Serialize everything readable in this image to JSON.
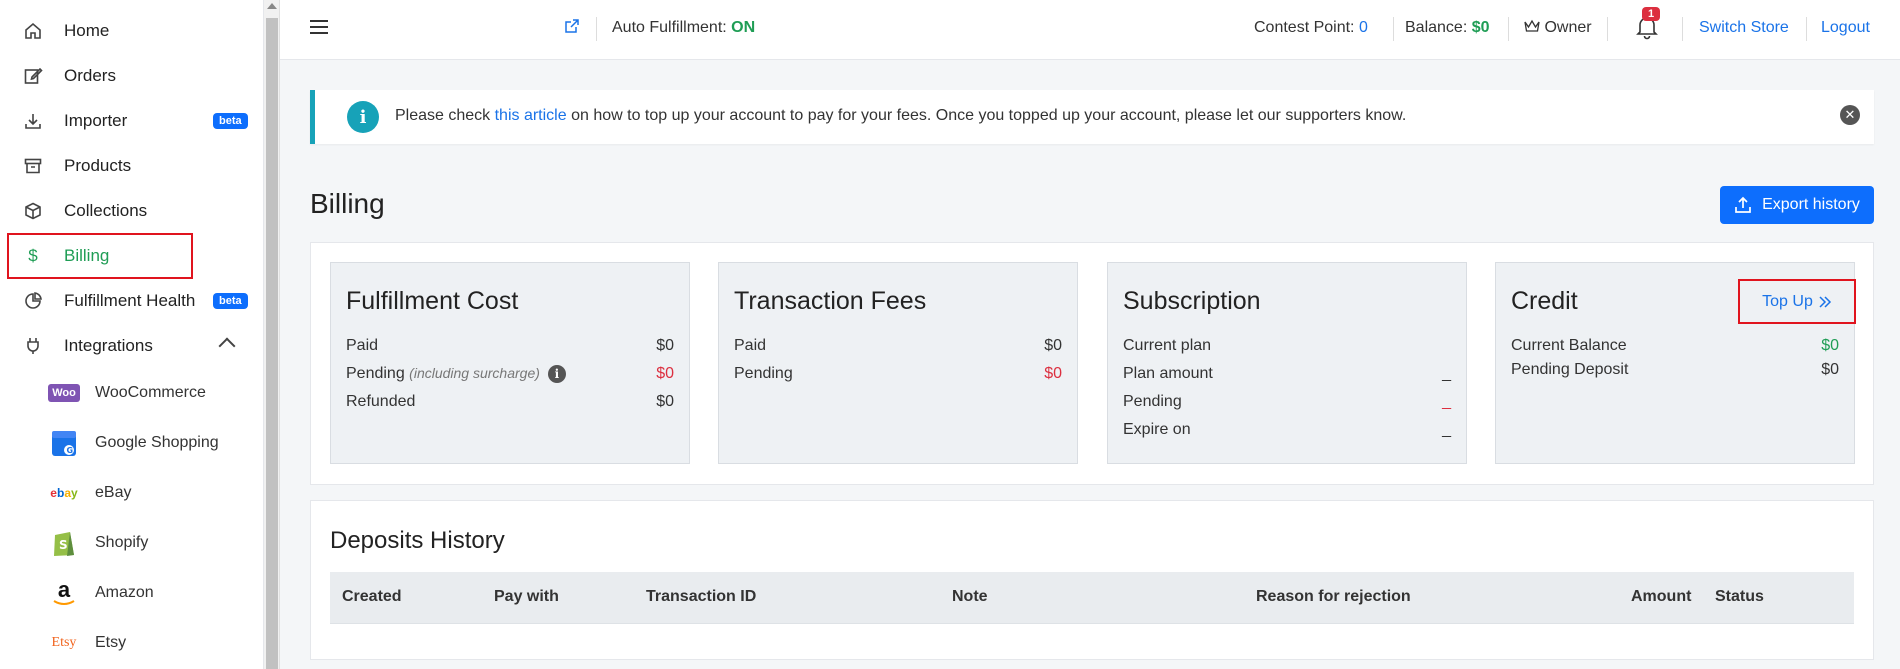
{
  "sidebar": {
    "items": [
      {
        "label": "Home"
      },
      {
        "label": "Orders"
      },
      {
        "label": "Importer",
        "badge": "beta"
      },
      {
        "label": "Products"
      },
      {
        "label": "Collections"
      },
      {
        "label": "Billing"
      },
      {
        "label": "Fulfillment Health",
        "badge": "beta"
      },
      {
        "label": "Integrations"
      }
    ],
    "integrations": [
      {
        "label": "WooCommerce",
        "logo_text": "Woo"
      },
      {
        "label": "Google Shopping"
      },
      {
        "label": "eBay",
        "logo_text": "ebay"
      },
      {
        "label": "Shopify"
      },
      {
        "label": "Amazon",
        "logo_text": "a"
      },
      {
        "label": "Etsy",
        "logo_text": "Etsy"
      }
    ]
  },
  "header": {
    "auto_fulfillment_label": "Auto Fulfillment:",
    "auto_fulfillment_value": "ON",
    "contest_label": "Contest Point:",
    "contest_value": "0",
    "balance_label": "Balance:",
    "balance_value": "$0",
    "owner_label": "Owner",
    "notification_count": "1",
    "switch_store": "Switch Store",
    "logout": "Logout"
  },
  "alert": {
    "prefix": "Please check ",
    "link": "this article",
    "suffix": " on how to top up your account to pay for your fees. Once you topped up your account, please let our supporters know."
  },
  "page": {
    "title": "Billing",
    "export_label": "Export history"
  },
  "cards": {
    "fulfillment": {
      "title": "Fulfillment Cost",
      "paid_label": "Paid",
      "paid_value": "$0",
      "pending_label": "Pending",
      "pending_note": "(including surcharge)",
      "pending_value": "$0",
      "refunded_label": "Refunded",
      "refunded_value": "$0"
    },
    "transaction": {
      "title": "Transaction Fees",
      "paid_label": "Paid",
      "paid_value": "$0",
      "pending_label": "Pending",
      "pending_value": "$0"
    },
    "subscription": {
      "title": "Subscription",
      "plan_label": "Current plan",
      "plan_value": "",
      "amount_label": "Plan amount",
      "amount_value": "_",
      "pending_label": "Pending",
      "pending_value": "_",
      "expire_label": "Expire on",
      "expire_value": "_"
    },
    "credit": {
      "title": "Credit",
      "topup_label": "Top Up",
      "balance_label": "Current Balance",
      "balance_value": "$0",
      "deposit_label": "Pending Deposit",
      "deposit_value": "$0"
    }
  },
  "deposits": {
    "title": "Deposits History",
    "columns": [
      "Created",
      "Pay with",
      "Transaction ID",
      "Note",
      "Reason for rejection",
      "Amount",
      "Status"
    ]
  },
  "colors": {
    "accent_blue": "#0d6efd",
    "link_blue": "#1a73e8",
    "green": "#1f9d55",
    "red": "#dc2f3f",
    "info_teal": "#17a2b8",
    "highlight_red": "#e0141e"
  }
}
